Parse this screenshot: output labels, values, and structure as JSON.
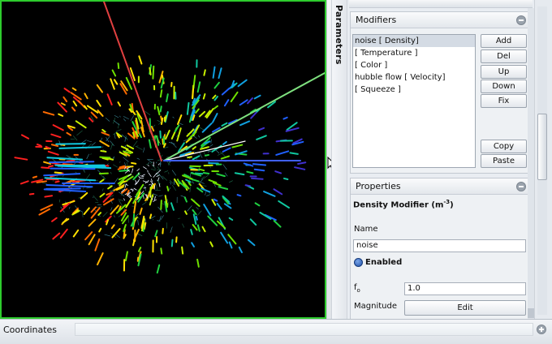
{
  "side_tab": {
    "label": "Parameters"
  },
  "modifiers": {
    "title": "Modifiers",
    "items": [
      {
        "label": "noise [ Density]",
        "selected": true
      },
      {
        "label": "[ Temperature ]",
        "selected": false
      },
      {
        "label": "[ Color ]",
        "selected": false
      },
      {
        "label": "hubble flow [ Velocity]",
        "selected": false
      },
      {
        "label": "[ Squeeze ]",
        "selected": false
      }
    ],
    "buttons": {
      "add": "Add",
      "del": "Del",
      "up": "Up",
      "down": "Down",
      "fix": "Fix",
      "copy": "Copy",
      "paste": "Paste"
    }
  },
  "properties": {
    "title": "Properties",
    "heading": "Density Modifier (m",
    "heading_sup": "-3",
    "heading_close": ")",
    "name_label": "Name",
    "name_value": "noise",
    "enabled_label": "Enabled",
    "f0_label": "f",
    "f0_sub": "o",
    "f0_value": "1.0",
    "magnitude_label": "Magnitude",
    "magnitude_button": "Edit"
  },
  "bottom": {
    "coordinates_label": "Coordinates"
  },
  "colors": {
    "viewport_border": "#2ecc2e",
    "axis_red": "#e04040",
    "axis_green": "#7ee07e",
    "selection": "#d4dbe4"
  },
  "icons": [
    "collapse-icon",
    "enabled-icon",
    "expand-icon",
    "mouse-cursor-icon"
  ]
}
